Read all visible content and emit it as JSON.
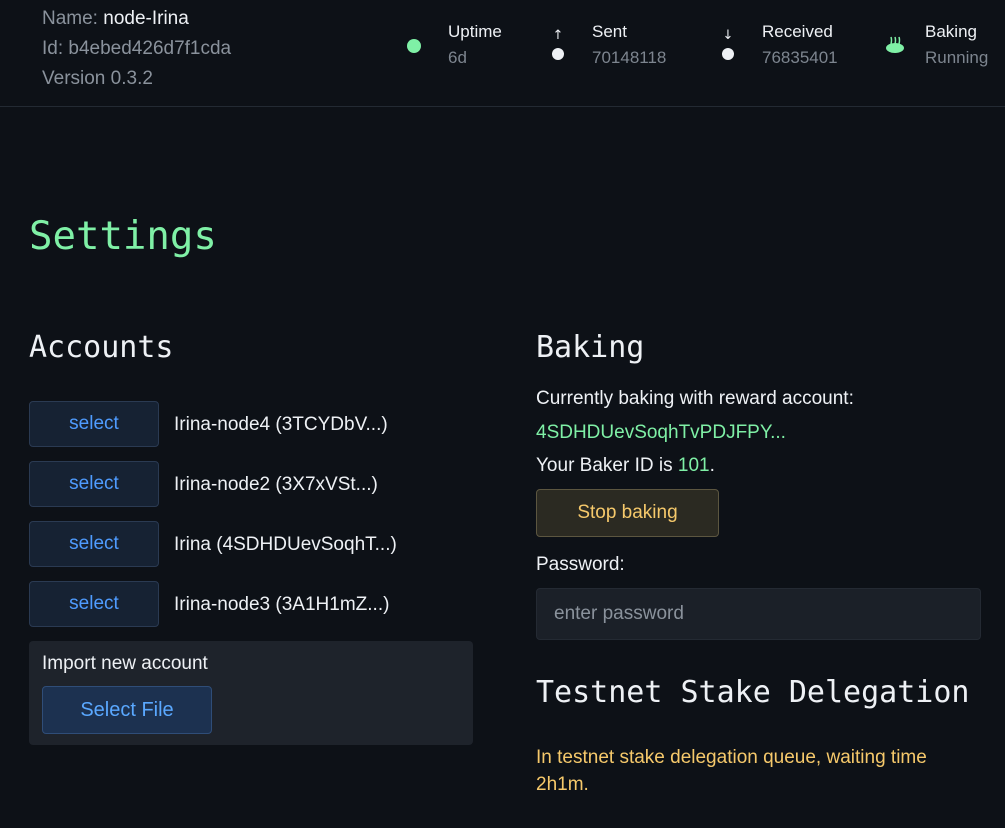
{
  "header": {
    "name_label": "Name:",
    "name_value": "node-Irina",
    "id_label": "Id:",
    "id_value": "b4ebed426d7f1cda",
    "version": "Version 0.3.2",
    "stats": {
      "uptime": {
        "label": "Uptime",
        "value": "6d",
        "icon": "status-dot-green"
      },
      "sent": {
        "label": "Sent",
        "value": "70148118",
        "icon": "upload-arrow-icon"
      },
      "received": {
        "label": "Received",
        "value": "76835401",
        "icon": "download-arrow-icon"
      },
      "baking": {
        "label": "Baking",
        "value": "Running",
        "icon": "bread-icon"
      }
    }
  },
  "page": {
    "title": "Settings"
  },
  "accounts": {
    "heading": "Accounts",
    "select_label": "select",
    "items": [
      {
        "name": "Irina-node4 (3TCYDbV...)"
      },
      {
        "name": "Irina-node2 (3X7xVSt...)"
      },
      {
        "name": "Irina (4SDHDUevSoqhT...)"
      },
      {
        "name": "Irina-node3 (3A1H1mZ...)"
      }
    ],
    "import": {
      "label": "Import new account",
      "button": "Select File"
    }
  },
  "baking": {
    "heading": "Baking",
    "current_text": "Currently baking with reward account:",
    "reward_account": "4SDHDUevSoqhTvPDJFPY...",
    "baker_id_prefix": "Your Baker ID is ",
    "baker_id": "101",
    "baker_id_suffix": ".",
    "stop_button": "Stop baking",
    "password_label": "Password:",
    "password_placeholder": "enter password"
  },
  "delegation": {
    "heading": "Testnet Stake Delegation",
    "message": "In testnet stake delegation queue, waiting time 2h1m."
  },
  "colors": {
    "background": "#0d1117",
    "accent_green": "#7ff0a6",
    "accent_blue": "#4f9cff",
    "warning_yellow": "#f6c96b"
  }
}
